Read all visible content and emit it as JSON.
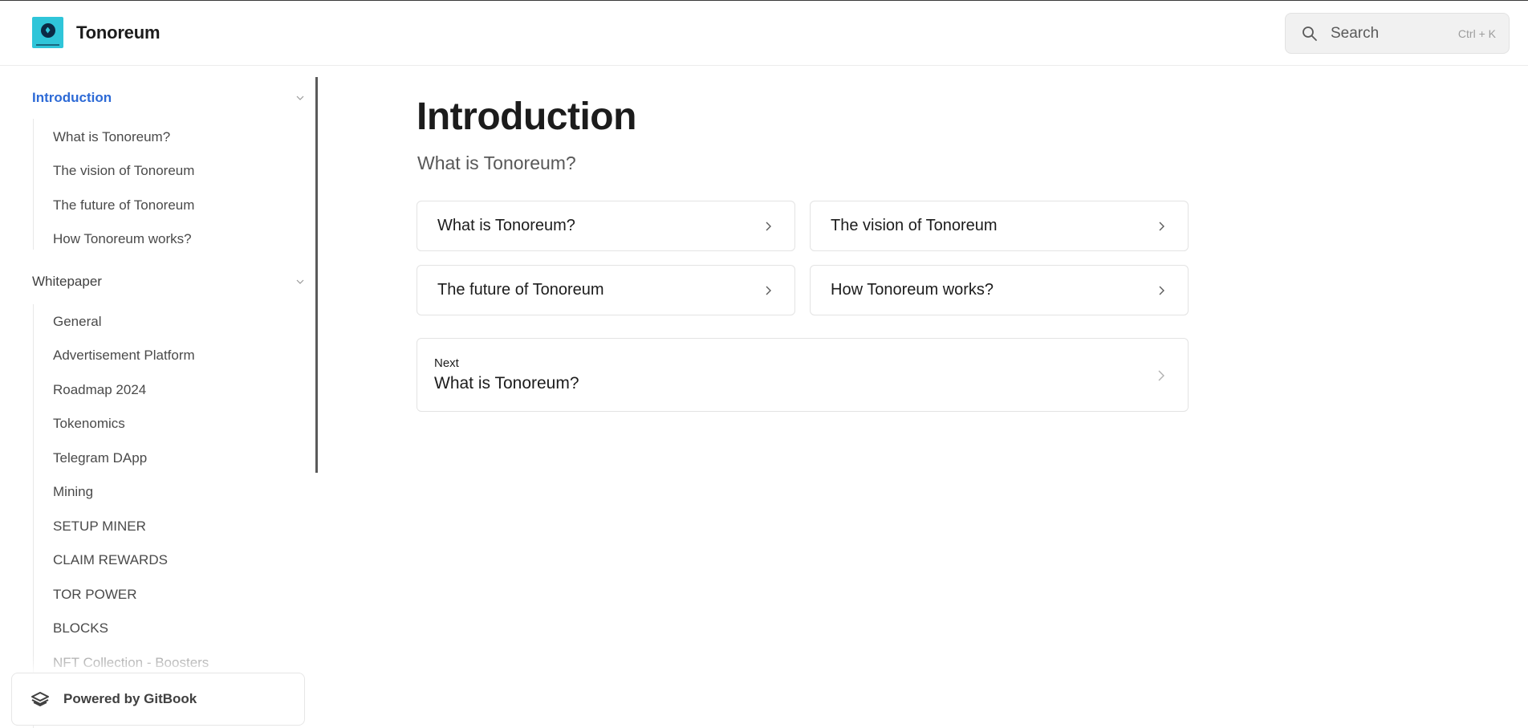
{
  "header": {
    "brand_name": "Tonoreum",
    "search": {
      "placeholder": "Search",
      "shortcut": "Ctrl + K"
    }
  },
  "sidebar": {
    "groups": [
      {
        "label": "Introduction",
        "active": true,
        "items": [
          "What is Tonoreum?",
          "The vision of Tonoreum",
          "The future of Tonoreum",
          "How Tonoreum works?"
        ]
      },
      {
        "label": "Whitepaper",
        "active": false,
        "items": [
          "General",
          "Advertisement Platform",
          "Roadmap 2024",
          "Tokenomics",
          "Telegram DApp",
          "Mining",
          "SETUP MINER",
          "CLAIM REWARDS",
          "TOR POWER",
          "BLOCKS",
          "NFT Collection - Boosters"
        ]
      }
    ],
    "powered_by": "Powered by GitBook"
  },
  "main": {
    "title": "Introduction",
    "description": "What is Tonoreum?",
    "cards": [
      "What is Tonoreum?",
      "The vision of Tonoreum",
      "The future of Tonoreum",
      "How Tonoreum works?"
    ],
    "next": {
      "kicker": "Next",
      "title": "What is Tonoreum?"
    }
  },
  "colors": {
    "accent": "#2d6ad6",
    "logo_bg": "#2fc5d9"
  }
}
